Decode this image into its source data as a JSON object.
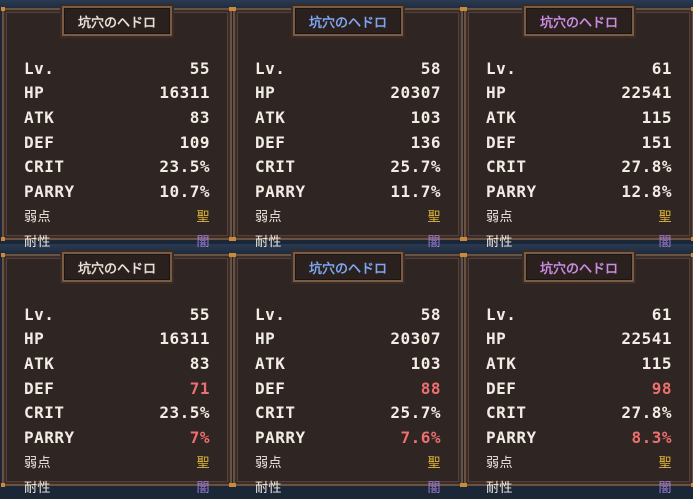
{
  "labels": {
    "lv": "Lv.",
    "hp": "HP",
    "atk": "ATK",
    "def": "DEF",
    "crit": "CRIT",
    "parry": "PARRY",
    "weak": "弱点",
    "resist": "耐性"
  },
  "cards": [
    {
      "title": "坑穴のヘドロ",
      "lv": "55",
      "hp": "16311",
      "atk": "83",
      "def": "109",
      "crit": "23.5%",
      "parry": "10.7%",
      "weak": "聖",
      "resist": "闇"
    },
    {
      "title": "坑穴のヘドロ",
      "lv": "58",
      "hp": "20307",
      "atk": "103",
      "def": "136",
      "crit": "25.7%",
      "parry": "11.7%",
      "weak": "聖",
      "resist": "闇"
    },
    {
      "title": "坑穴のヘドロ",
      "lv": "61",
      "hp": "22541",
      "atk": "115",
      "def": "151",
      "crit": "27.8%",
      "parry": "12.8%",
      "weak": "聖",
      "resist": "闇"
    },
    {
      "title": "坑穴のヘドロ",
      "lv": "55",
      "hp": "16311",
      "atk": "83",
      "def": "71",
      "crit": "23.5%",
      "parry": "7%",
      "weak": "聖",
      "resist": "闇"
    },
    {
      "title": "坑穴のヘドロ",
      "lv": "58",
      "hp": "20307",
      "atk": "103",
      "def": "88",
      "crit": "25.7%",
      "parry": "7.6%",
      "weak": "聖",
      "resist": "闇"
    },
    {
      "title": "坑穴のヘドロ",
      "lv": "61",
      "hp": "22541",
      "atk": "115",
      "def": "98",
      "crit": "27.8%",
      "parry": "8.3%",
      "weak": "聖",
      "resist": "闇"
    }
  ],
  "colors": {
    "title_default": "#e7e0d6",
    "title_blue": "#7ea6f0",
    "title_purple": "#c98ce0",
    "reduced_stat": "#ee6f6f",
    "weakness": "#e0b63a",
    "resistance": "#9e7fd8"
  }
}
